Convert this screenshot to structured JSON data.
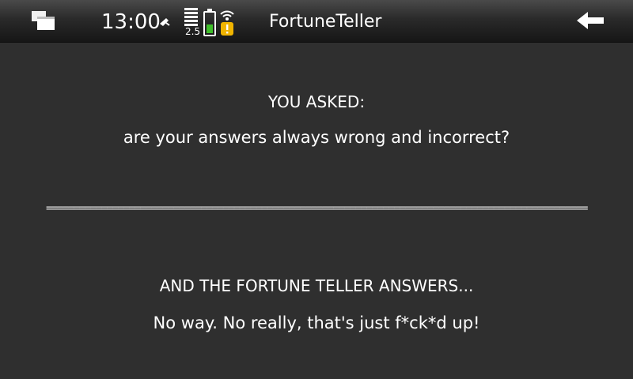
{
  "statusbar": {
    "time": "13:00",
    "network_label": "2.5",
    "app_title": "FortuneTeller",
    "icons": {
      "task_switcher": "task-switcher-icon",
      "alarm": "alarm-icon",
      "signal": "signal-bars-icon",
      "battery": "battery-icon",
      "wifi": "wifi-warning-icon",
      "back": "back-arrow-icon"
    },
    "battery_level": 0.4,
    "colors": {
      "battery_fill": "#3fbf2a",
      "wifi_warning": "#f0b400"
    }
  },
  "content": {
    "asked_heading": "YOU ASKED:",
    "question": "are your answers always wrong and incorrect?",
    "separator": "==================================================================================================",
    "answers_heading": "AND THE FORTUNE TELLER ANSWERS...",
    "answer": "No way. No really, that's just f*ck*d up!"
  },
  "colors": {
    "background": "#2f2f2f",
    "text": "#ffffff"
  }
}
